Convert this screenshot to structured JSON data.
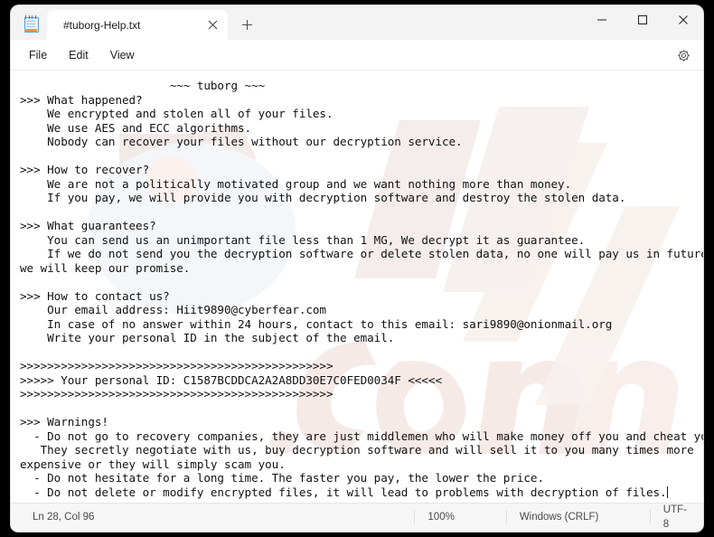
{
  "window": {
    "app_icon": "notepad-icon",
    "caption": {
      "minimize": "minimize-icon",
      "maximize": "maximize-icon",
      "close": "close-icon"
    }
  },
  "tabs": [
    {
      "title": "#tuborg-Help.txt",
      "close_label": "close-tab-icon"
    }
  ],
  "new_tab_label": "new-tab-icon",
  "menubar": {
    "items": [
      {
        "label": "File"
      },
      {
        "label": "Edit"
      },
      {
        "label": "View"
      }
    ],
    "settings_label": "gear-icon"
  },
  "document": {
    "lines": [
      "                      ~~~ tuborg ~~~",
      ">>> What happened?",
      "    We encrypted and stolen all of your files.",
      "    We use AES and ECC algorithms.",
      "    Nobody can recover your files without our decryption service.",
      "",
      ">>> How to recover?",
      "    We are not a politically motivated group and we want nothing more than money.",
      "    If you pay, we will provide you with decryption software and destroy the stolen data.",
      "",
      ">>> What guarantees?",
      "    You can send us an unimportant file less than 1 MG, We decrypt it as guarantee.",
      "    If we do not send you the decryption software or delete stolen data, no one will pay us in future so",
      "we will keep our promise.",
      "",
      ">>> How to contact us?",
      "    Our email address: Hiit9890@cyberfear.com",
      "    In case of no answer within 24 hours, contact to this email: sari9890@onionmail.org",
      "    Write your personal ID in the subject of the email.",
      "",
      ">>>>>>>>>>>>>>>>>>>>>>>>>>>>>>>>>>>>>>>>>>>>>>",
      ">>>>> Your personal ID: C1587BCDDCA2A2A8DD30E7C0FED0034F <<<<<",
      ">>>>>>>>>>>>>>>>>>>>>>>>>>>>>>>>>>>>>>>>>>>>>>",
      "",
      ">>> Warnings!",
      "  - Do not go to recovery companies, they are just middlemen who will make money off you and cheat you.",
      "   They secretly negotiate with us, buy decryption software and will sell it to you many times more",
      "expensive or they will simply scam you.",
      "  - Do not hesitate for a long time. The faster you pay, the lower the price.",
      "  - Do not delete or modify encrypted files, it will lead to problems with decryption of files."
    ],
    "caret_line_index": 29,
    "personal_id": "C1587BCDDCA2A2A8DD30E7C0FED0034F",
    "emails": [
      "Hiit9890@cyberfear.com",
      "sari9890@onionmail.org"
    ],
    "ransomware_name": "tuborg"
  },
  "watermark": {
    "text": "pcrisk.com",
    "color": "#f4ece9"
  },
  "statusbar": {
    "position": "Ln 28, Col 96",
    "zoom": "100%",
    "line_ending": "Windows (CRLF)",
    "encoding": "UTF-8"
  }
}
